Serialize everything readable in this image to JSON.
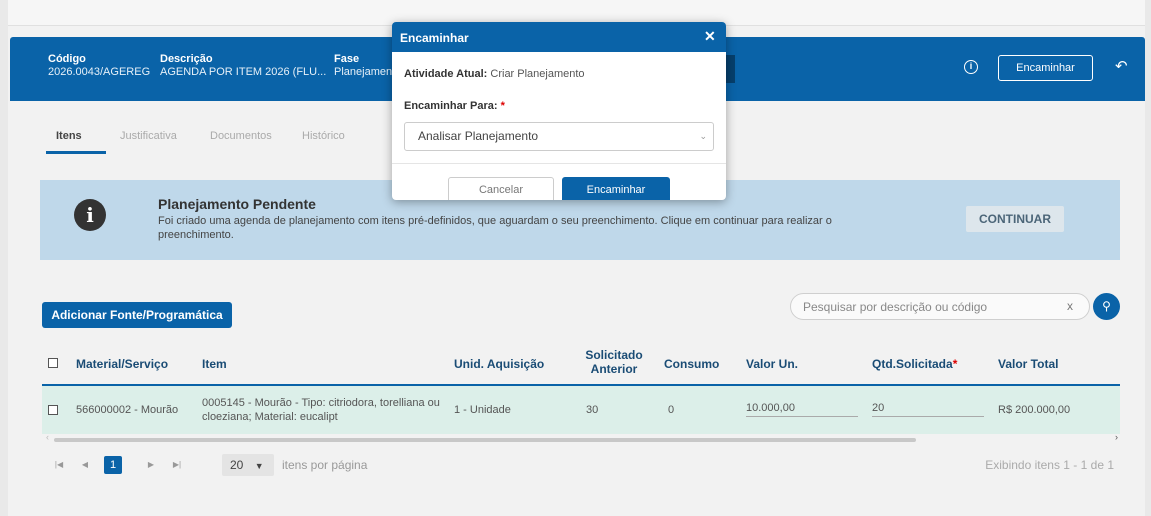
{
  "header": {
    "codigo_label": "Código",
    "codigo_value": "2026.0043/AGEREG",
    "descricao_label": "Descrição",
    "descricao_value": "AGENDA POR ITEM 2026 (FLU...",
    "fase_label": "Fase",
    "fase_value": "Planejamen",
    "encaminhar_label": "Encaminhar",
    "info_icon": "info-icon",
    "undo_icon": "undo-icon"
  },
  "tabs": [
    {
      "label": "Itens",
      "active": true
    },
    {
      "label": "Justificativa",
      "active": false
    },
    {
      "label": "Documentos",
      "active": false
    },
    {
      "label": "Histórico",
      "active": false
    }
  ],
  "alert": {
    "title": "Planejamento Pendente",
    "text": "Foi criado uma agenda de planejamento com itens pré-definidos, que aguardam o seu preenchimento. Clique em continuar para realizar o preenchimento.",
    "button": "CONTINUAR"
  },
  "toolbar": {
    "add_button": "Adicionar Fonte/Programática",
    "search_placeholder": "Pesquisar por descrição ou código",
    "search_clear": "x"
  },
  "table": {
    "columns": [
      "Material/Serviço",
      "Item",
      "Unid. Aquisição",
      "Solicitado Anterior",
      "Consumo",
      "Valor Un.",
      "Qtd.Solicitada",
      "Valor Total"
    ],
    "required_mark": "*",
    "rows": [
      {
        "material": "566000002 - Mourão",
        "item": "0005145 - Mourão - Tipo: citriodora, torelliana ou cloeziana; Material: eucalipt",
        "unid": "1 - Unidade",
        "solicitado_anterior": "30",
        "consumo": "0",
        "valor_un": "10.000,00",
        "qtd_solicitada": "20",
        "valor_total": "R$ 200.000,00"
      }
    ]
  },
  "pager": {
    "current_page": "1",
    "page_size": "20",
    "page_size_label": "itens por página",
    "info": "Exibindo itens 1 - 1 de 1"
  },
  "modal": {
    "title": "Encaminhar",
    "atividade_label": "Atividade Atual:",
    "atividade_value": "Criar Planejamento",
    "encaminhar_para_label": "Encaminhar Para:",
    "required_mark": "*",
    "select_value": "Analisar Planejamento",
    "cancel_label": "Cancelar",
    "ok_label": "Encaminhar"
  },
  "colors": {
    "primary": "#0a63a8",
    "alert_bg": "#bfd8ea",
    "row_selected": "#dcefe9"
  }
}
